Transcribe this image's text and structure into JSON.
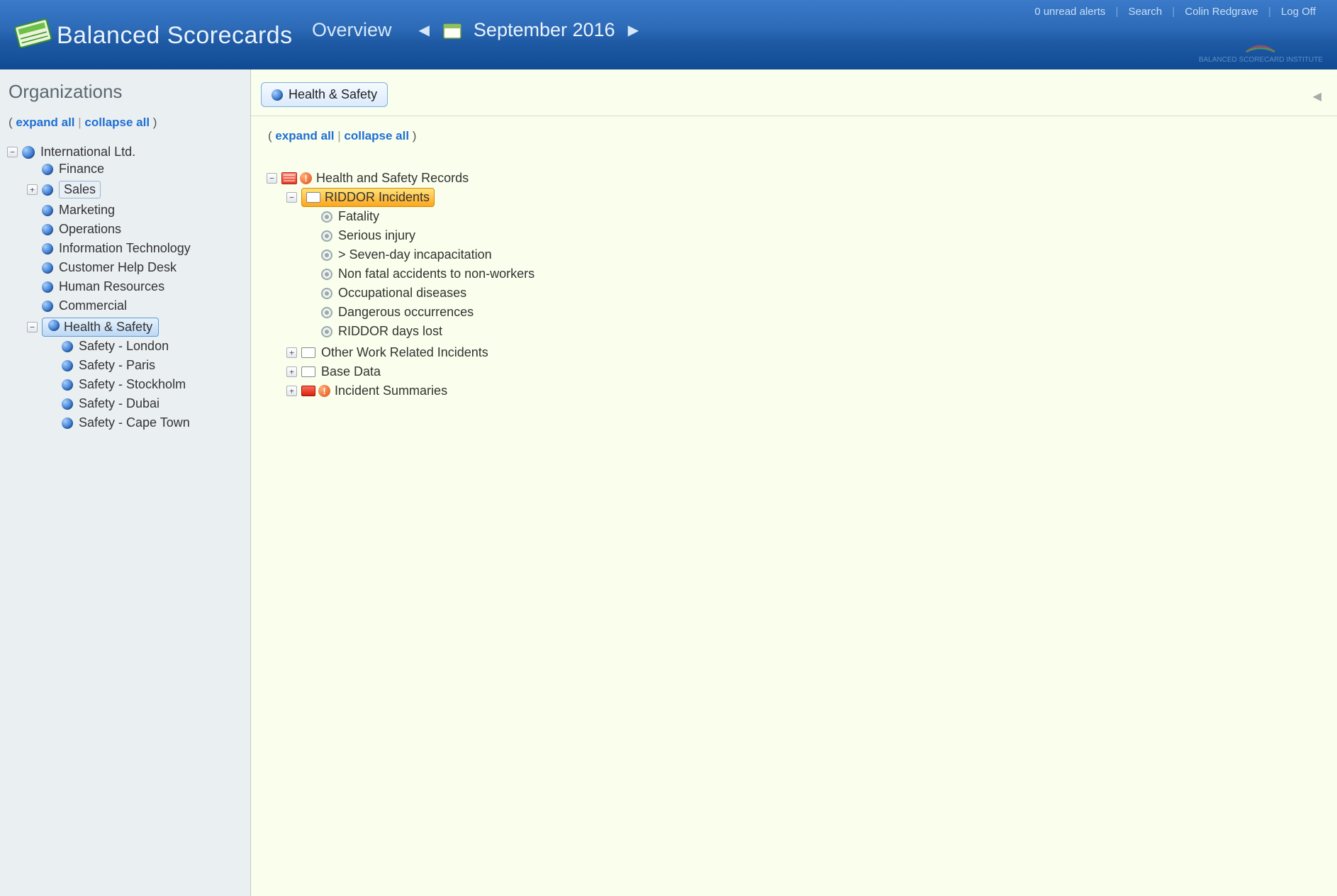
{
  "header": {
    "app_title": "Balanced Scorecards",
    "nav_label": "Overview",
    "period_label": "September 2016",
    "alerts_text": "0 unread alerts",
    "search_label": "Search",
    "user_name": "Colin Redgrave",
    "logoff_label": "Log Off",
    "bsi_text": "BALANCED SCORECARD INSTITUTE"
  },
  "sidebar": {
    "title": "Organizations",
    "expand_label": "expand all",
    "collapse_label": "collapse all",
    "root": {
      "label": "International Ltd.",
      "children": [
        {
          "label": "Finance"
        },
        {
          "label": "Sales",
          "boxed": true,
          "expandable": true
        },
        {
          "label": "Marketing"
        },
        {
          "label": "Operations"
        },
        {
          "label": "Information Technology"
        },
        {
          "label": "Customer Help Desk"
        },
        {
          "label": "Human Resources"
        },
        {
          "label": "Commercial"
        },
        {
          "label": "Health & Safety",
          "selected": true,
          "expanded": true,
          "children": [
            {
              "label": "Safety - London"
            },
            {
              "label": "Safety - Paris"
            },
            {
              "label": "Safety - Stockholm"
            },
            {
              "label": "Safety - Dubai"
            },
            {
              "label": "Safety - Cape Town"
            }
          ]
        }
      ]
    }
  },
  "main": {
    "breadcrumb": "Health & Safety",
    "expand_label": "expand all",
    "collapse_label": "collapse all",
    "tree": {
      "label": "Health and Safety Records",
      "children": [
        {
          "label": "RIDDOR Incidents",
          "highlighted": true,
          "expanded": true,
          "items": [
            "Fatality",
            "Serious injury",
            "> Seven-day incapacitation",
            "Non fatal accidents to non-workers",
            "Occupational diseases",
            "Dangerous occurrences",
            "RIDDOR days lost"
          ]
        },
        {
          "label": "Other Work Related Incidents"
        },
        {
          "label": "Base Data"
        },
        {
          "label": "Incident Summaries",
          "status": "red",
          "alert": true
        }
      ]
    }
  }
}
